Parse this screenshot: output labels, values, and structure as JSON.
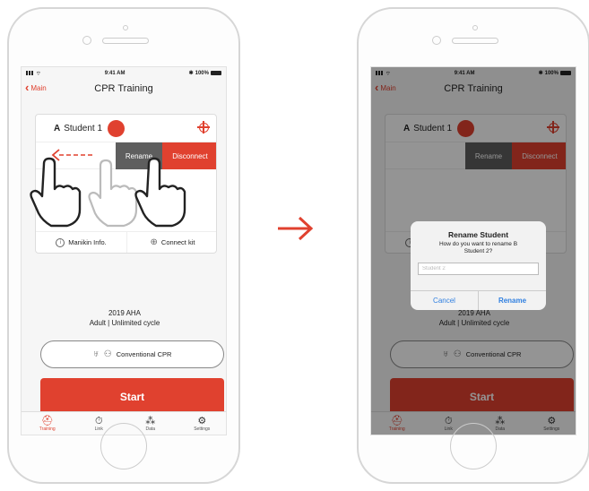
{
  "status": {
    "time": "9:41 AM",
    "battery": "100%"
  },
  "nav": {
    "back_label": "Main",
    "title": "CPR Training"
  },
  "student": {
    "letter": "A",
    "name": "Student 1"
  },
  "swipe_actions": {
    "rename": "Rename",
    "disconnect": "Disconnect"
  },
  "card_footer": {
    "manikin_info": "Manikin Info.",
    "connect_kit": "Connect kit"
  },
  "protocol": {
    "line1": "2019 AHA",
    "line2": "Adult | Unlimited cycle"
  },
  "cpr_mode": "Conventional CPR",
  "start": "Start",
  "tabs": [
    {
      "label": "Training",
      "icon": "training-icon"
    },
    {
      "label": "Link",
      "icon": "link-icon"
    },
    {
      "label": "Data",
      "icon": "data-icon"
    },
    {
      "label": "Settings",
      "icon": "settings-icon"
    }
  ],
  "dialog": {
    "title": "Rename Student",
    "message": "How do you want to rename B Student 2?",
    "placeholder": "Student 2",
    "cancel": "Cancel",
    "confirm": "Rename"
  },
  "colors": {
    "accent": "#e0412f",
    "dialog_button": "#2f7fe0"
  }
}
